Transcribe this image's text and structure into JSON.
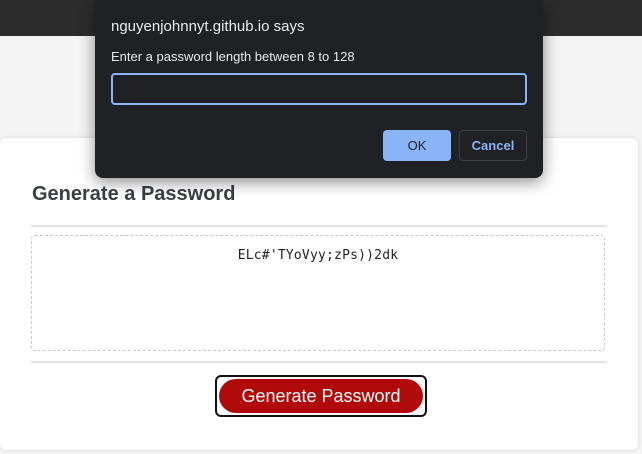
{
  "page": {
    "card_title": "Generate a Password",
    "password_value": "ELc#'TYoVyy;zPs))2dk",
    "generate_button_label": "Generate Password"
  },
  "dialog": {
    "origin": "nguyenjohnnyt.github.io says",
    "message": "Enter a password length between 8 to 128",
    "input_value": "",
    "ok_label": "OK",
    "cancel_label": "Cancel"
  },
  "colors": {
    "accent_red": "#b00a0a",
    "dialog_bg": "#202124",
    "dialog_accent": "#8ab4f8",
    "top_bar": "#2c2c2c"
  }
}
